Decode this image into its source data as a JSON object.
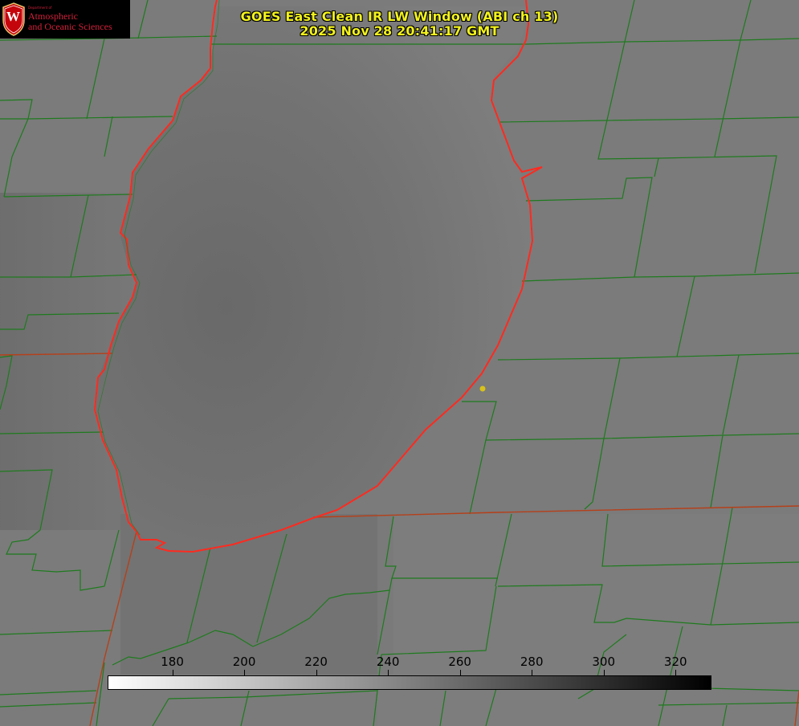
{
  "title": {
    "line1": "GOES East Clean IR LW Window (ABI ch 13)",
    "line2": "2025 Nov 28 20:41:17 GMT"
  },
  "logo": {
    "dept": "Department of",
    "line1": "Atmospheric",
    "line2": "and Oceanic Sciences",
    "crest_letter": "W"
  },
  "colorbar": {
    "ticks": [
      "180",
      "200",
      "220",
      "240",
      "260",
      "280",
      "300",
      "320"
    ],
    "min": 162,
    "max": 330,
    "from_color": "#ffffff",
    "to_color": "#000000"
  },
  "colors": {
    "lake_outline": "#ff2a1f",
    "county_lines": "#1e7a1e",
    "state_line": "#b5401a",
    "marker": "#d8c21a"
  }
}
